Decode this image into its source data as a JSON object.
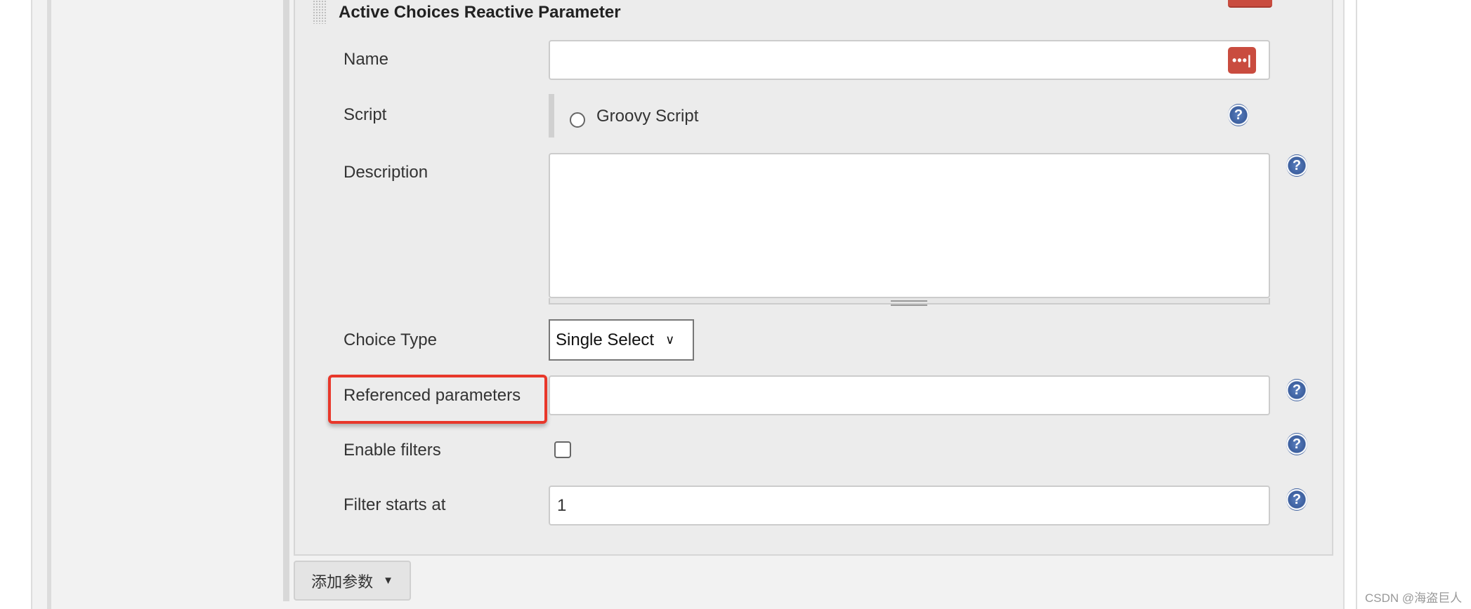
{
  "parameter": {
    "title": "Active Choices Reactive Parameter",
    "fields": {
      "name": {
        "label": "Name",
        "value": ""
      },
      "script": {
        "label": "Script",
        "option": "Groovy Script",
        "selected": false
      },
      "description": {
        "label": "Description",
        "value": ""
      },
      "choice_type": {
        "label": "Choice Type",
        "value": "Single Select"
      },
      "referenced_parameters": {
        "label": "Referenced parameters",
        "value": "",
        "highlighted": true
      },
      "enable_filters": {
        "label": "Enable filters",
        "checked": false
      },
      "filter_starts_at": {
        "label": "Filter starts at",
        "value": "1"
      }
    },
    "password_manager_icon": "•••|",
    "help_icon": "?"
  },
  "add_parameter_button": {
    "label": "添加参数",
    "arrow": "▼"
  },
  "watermark": "CSDN @海盗巨人",
  "colors": {
    "accent_red": "#c94c3f",
    "highlight_red": "#e8372a",
    "help_blue": "#3c5f9e",
    "panel_bg": "#ececec"
  }
}
